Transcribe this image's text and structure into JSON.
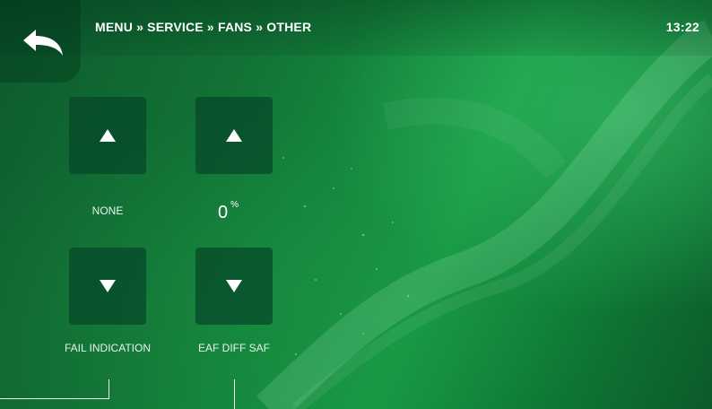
{
  "header": {
    "breadcrumb": "MENU » SERVICE » FANS » OTHER",
    "time": "13:22"
  },
  "controls": [
    {
      "label": "FAIL INDICATION",
      "value": "NONE",
      "unit": ""
    },
    {
      "label": "EAF DIFF SAF",
      "value": "0",
      "unit": "%"
    }
  ],
  "icons": {
    "back": "back-arrow-icon",
    "up": "triangle-up-icon",
    "down": "triangle-down-icon"
  },
  "colors": {
    "background": "#179a44",
    "tile": "#054628",
    "text": "#ffffff"
  }
}
